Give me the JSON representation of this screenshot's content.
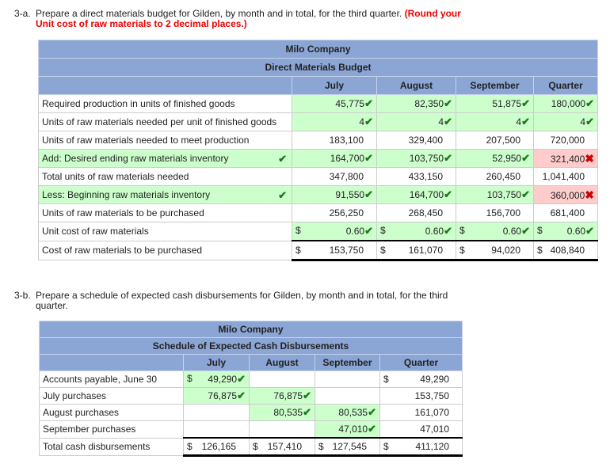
{
  "q3a": {
    "number": "3-a.",
    "text": "Prepare a direct materials budget for Gilden, by month and in total, for the third quarter.",
    "note": "(Round your Unit cost of raw materials to 2 decimal places.)"
  },
  "budget": {
    "company": "Milo Company",
    "title": "Direct Materials Budget",
    "columns": [
      "July",
      "August",
      "September",
      "Quarter"
    ],
    "rows": [
      {
        "label": "Required production in units of finished goods",
        "cells": [
          {
            "v": "45,775",
            "m": "check",
            "bg": "green"
          },
          {
            "v": "82,350",
            "m": "check",
            "bg": "green"
          },
          {
            "v": "51,875",
            "m": "check",
            "bg": "green"
          },
          {
            "v": "180,000",
            "m": "check",
            "bg": "green"
          }
        ]
      },
      {
        "label": "Units of raw materials needed per unit of finished goods",
        "cells": [
          {
            "v": "4",
            "m": "check",
            "bg": "green"
          },
          {
            "v": "4",
            "m": "check",
            "bg": "green"
          },
          {
            "v": "4",
            "m": "check",
            "bg": "green"
          },
          {
            "v": "4",
            "m": "check",
            "bg": "green"
          }
        ]
      },
      {
        "label": "Units of raw materials needed to meet production",
        "cells": [
          {
            "v": "183,100"
          },
          {
            "v": "329,400"
          },
          {
            "v": "207,500"
          },
          {
            "v": "720,000"
          }
        ]
      },
      {
        "label": "Add: Desired ending raw materials inventory",
        "label_check": true,
        "label_bg": "green",
        "cells": [
          {
            "v": "164,700",
            "m": "check",
            "bg": "green"
          },
          {
            "v": "103,750",
            "m": "check",
            "bg": "green"
          },
          {
            "v": "52,950",
            "m": "check",
            "bg": "green"
          },
          {
            "v": "321,400",
            "m": "x",
            "bg": "red"
          }
        ]
      },
      {
        "label": "Total units of raw materials needed",
        "cells": [
          {
            "v": "347,800"
          },
          {
            "v": "433,150"
          },
          {
            "v": "260,450"
          },
          {
            "v": "1,041,400"
          }
        ]
      },
      {
        "label": "Less: Beginning raw materials inventory",
        "label_check": true,
        "label_bg": "green",
        "cells": [
          {
            "v": "91,550",
            "m": "check",
            "bg": "green"
          },
          {
            "v": "164,700",
            "m": "check",
            "bg": "green"
          },
          {
            "v": "103,750",
            "m": "check",
            "bg": "green"
          },
          {
            "v": "360,000",
            "m": "x",
            "bg": "red"
          }
        ]
      },
      {
        "label": "Units of raw materials to be purchased",
        "cells": [
          {
            "v": "256,250"
          },
          {
            "v": "268,450"
          },
          {
            "v": "156,700"
          },
          {
            "v": "681,400"
          }
        ]
      },
      {
        "label": "Unit cost of raw materials",
        "cells": [
          {
            "d": "$",
            "v": "0.60",
            "m": "check",
            "bg": "green"
          },
          {
            "d": "$",
            "v": "0.60",
            "m": "check",
            "bg": "green"
          },
          {
            "d": "$",
            "v": "0.60",
            "m": "check",
            "bg": "green"
          },
          {
            "d": "$",
            "v": "0.60",
            "m": "check",
            "bg": "green"
          }
        ]
      },
      {
        "label": "Cost of raw materials to be purchased",
        "total": true,
        "cells": [
          {
            "d": "$",
            "v": "153,750"
          },
          {
            "d": "$",
            "v": "161,070"
          },
          {
            "d": "$",
            "v": "94,020"
          },
          {
            "d": "$",
            "v": "408,840"
          }
        ]
      }
    ]
  },
  "q3b": {
    "number": "3-b.",
    "text": "Prepare a schedule of expected cash disbursements for Gilden, by month and in total, for the third quarter."
  },
  "cash": {
    "company": "Milo Company",
    "title": "Schedule of Expected Cash Disbursements",
    "columns": [
      "July",
      "August",
      "September",
      "Quarter"
    ],
    "rows": [
      {
        "label": "Accounts payable, June 30",
        "cells": [
          {
            "d": "$",
            "v": "49,290",
            "m": "check",
            "bg": "green"
          },
          {},
          {},
          {
            "d": "$",
            "v": "49,290"
          }
        ]
      },
      {
        "label": "July purchases",
        "cells": [
          {
            "v": "76,875",
            "m": "check",
            "bg": "green"
          },
          {
            "v": "76,875",
            "m": "check",
            "bg": "green"
          },
          {},
          {
            "v": "153,750"
          }
        ]
      },
      {
        "label": "August purchases",
        "cells": [
          {},
          {
            "v": "80,535",
            "m": "check",
            "bg": "green"
          },
          {
            "v": "80,535",
            "m": "check",
            "bg": "green"
          },
          {
            "v": "161,070"
          }
        ]
      },
      {
        "label": "September purchases",
        "cells": [
          {},
          {},
          {
            "v": "47,010",
            "m": "check",
            "bg": "green"
          },
          {
            "v": "47,010"
          }
        ]
      },
      {
        "label": "Total cash disbursements",
        "total": true,
        "cells": [
          {
            "d": "$",
            "v": "126,165"
          },
          {
            "d": "$",
            "v": "157,410"
          },
          {
            "d": "$",
            "v": "127,545"
          },
          {
            "d": "$",
            "v": "411,120"
          }
        ]
      }
    ]
  },
  "colors": {
    "header": "#8ba5d4",
    "correct": "#ccffcc",
    "incorrect": "#ffcccc",
    "check": "#1a7a1a",
    "x": "#cc0000"
  }
}
